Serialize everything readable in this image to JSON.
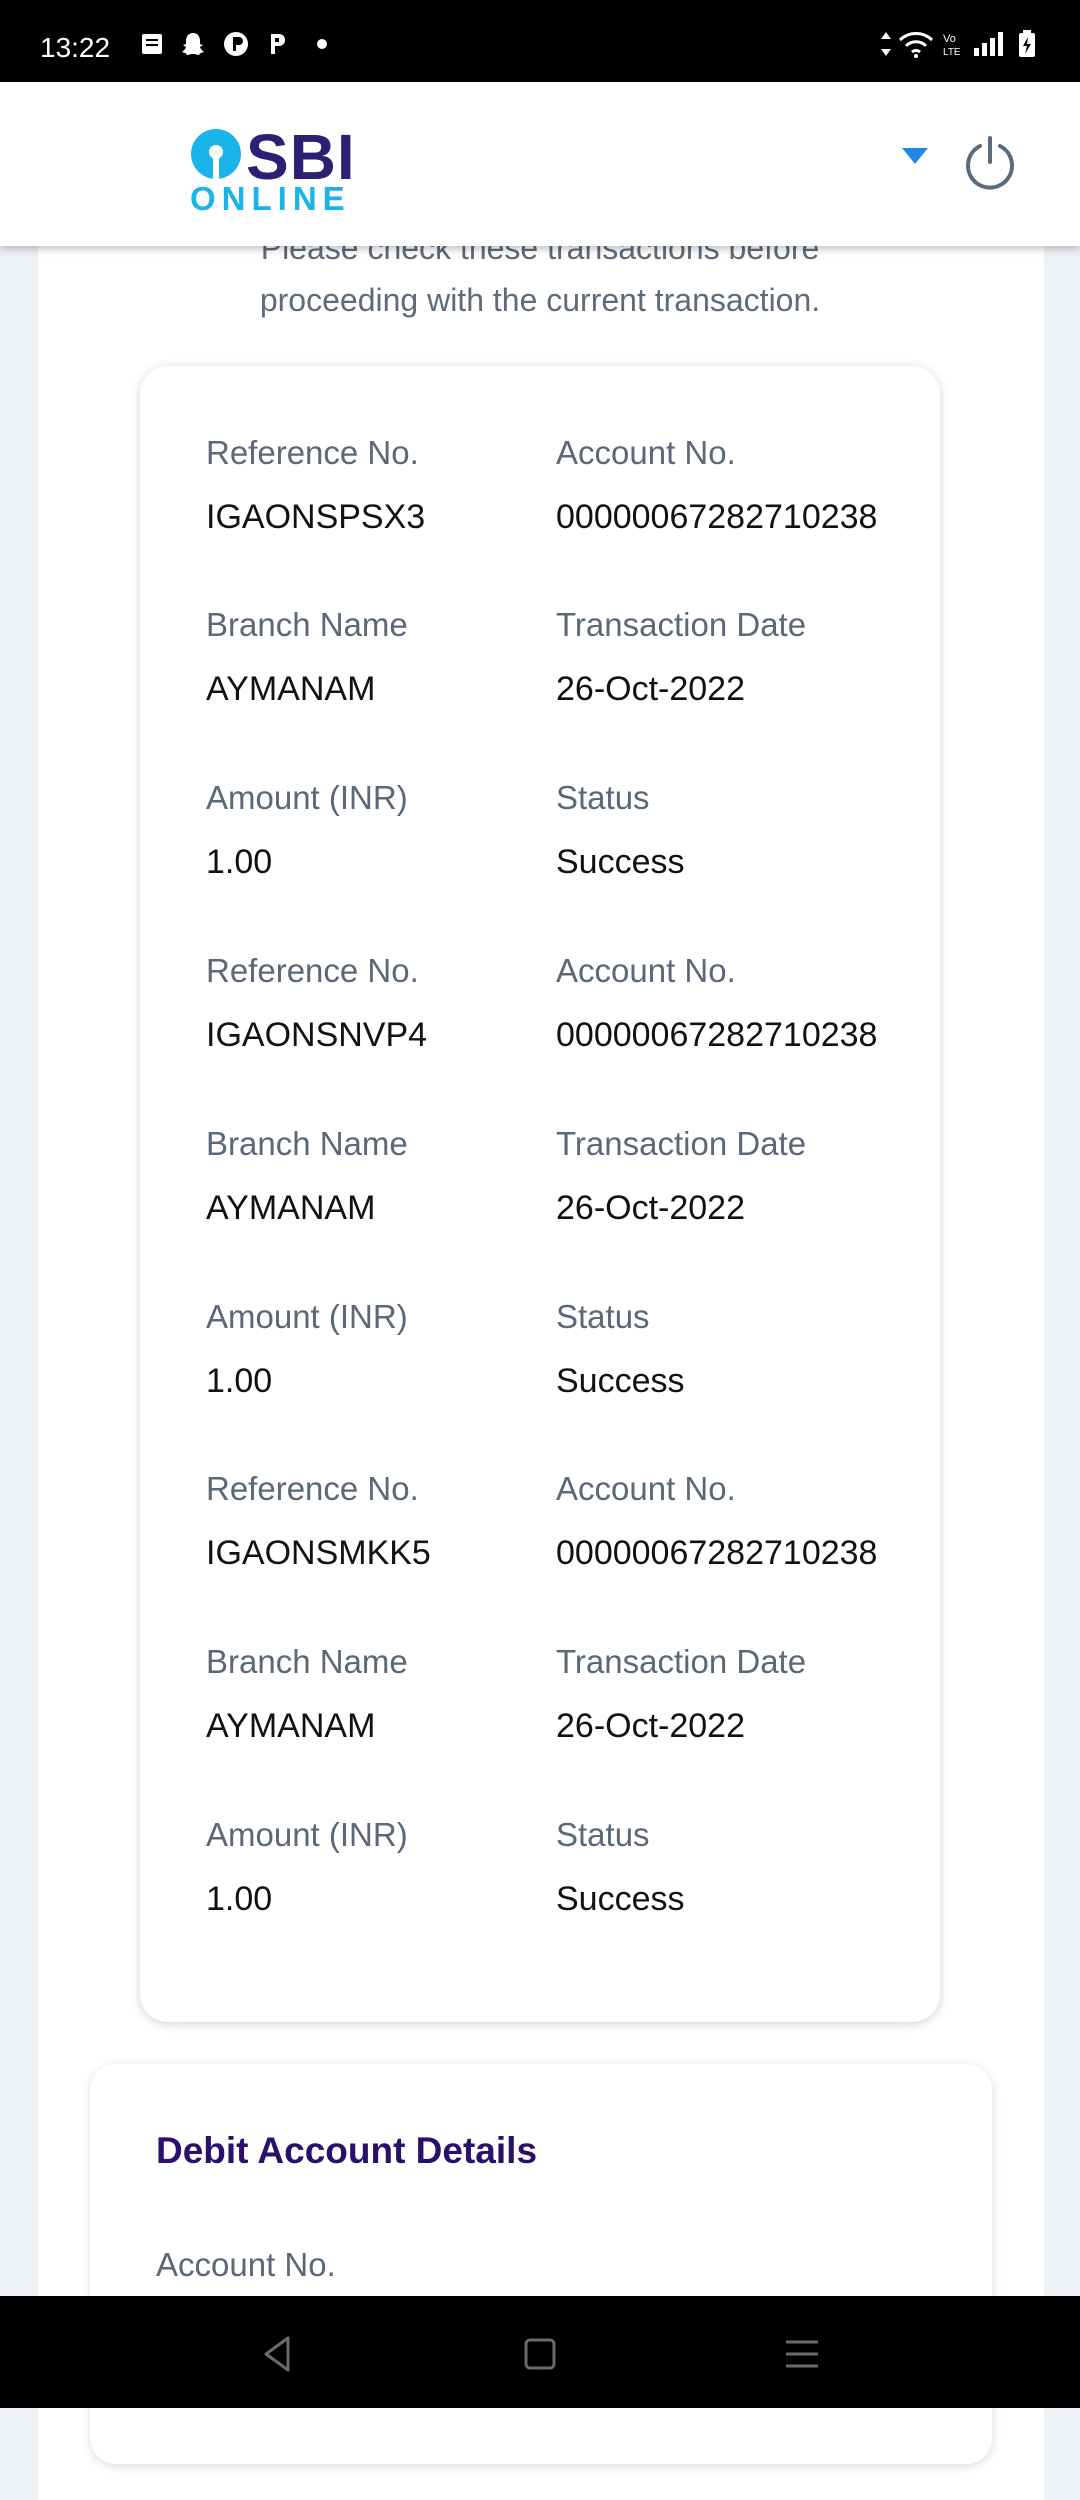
{
  "status_bar": {
    "time": "13:22"
  },
  "header": {
    "logo_text": "SBI",
    "logo_subtext": "ONLINE"
  },
  "intro_text_line1": "Please check these transactions before",
  "intro_text_line2": "proceeding with the current transaction.",
  "transactions": [
    {
      "reference_label": "Reference No.",
      "reference": "IGAONSPSX3",
      "account_label": "Account No.",
      "account": "00000067282710238",
      "branch_label": "Branch Name",
      "branch": "AYMANAM",
      "date_label": "Transaction Date",
      "date": "26-Oct-2022",
      "amount_label": "Amount (INR)",
      "amount": "1.00",
      "status_label": "Status",
      "status": "Success"
    },
    {
      "reference_label": "Reference No.",
      "reference": "IGAONSNVP4",
      "account_label": "Account No.",
      "account": "00000067282710238",
      "branch_label": "Branch Name",
      "branch": "AYMANAM",
      "date_label": "Transaction Date",
      "date": "26-Oct-2022",
      "amount_label": "Amount (INR)",
      "amount": "1.00",
      "status_label": "Status",
      "status": "Success"
    },
    {
      "reference_label": "Reference No.",
      "reference": "IGAONSMKK5",
      "account_label": "Account No.",
      "account": "00000067282710238",
      "branch_label": "Branch Name",
      "branch": "AYMANAM",
      "date_label": "Transaction Date",
      "date": "26-Oct-2022",
      "amount_label": "Amount (INR)",
      "amount": "1.00",
      "status_label": "Status",
      "status": "Success"
    }
  ],
  "debit": {
    "title": "Debit Account Details",
    "account_label": "Account No."
  },
  "colors": {
    "brand_blue": "#2b2173",
    "brand_cyan": "#1ab4e8",
    "accent": "#1e88e5",
    "title_purple": "#2a0f6b"
  },
  "icons": [
    "notification-icon",
    "snapchat-icon",
    "app-icon",
    "pinterest-icon",
    "wifi-icon",
    "signal-icon",
    "battery-icon",
    "dropdown-icon",
    "power-icon",
    "back-icon",
    "home-icon",
    "menu-icon"
  ]
}
